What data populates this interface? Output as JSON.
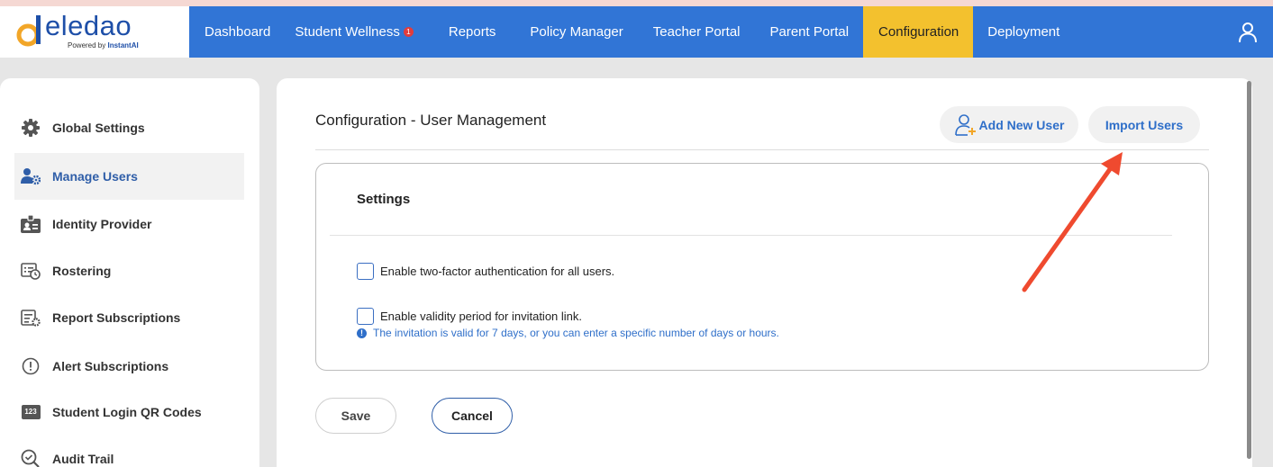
{
  "brand": {
    "name": "eledao",
    "powered_prefix": "Powered by",
    "powered_brand": "InstantAI"
  },
  "nav": {
    "items": [
      {
        "label": "Dashboard",
        "active": false
      },
      {
        "label": "Student Wellness",
        "active": false,
        "badge": "1"
      },
      {
        "label": "Reports",
        "active": false
      },
      {
        "label": "Policy Manager",
        "active": false
      },
      {
        "label": "Teacher Portal",
        "active": false
      },
      {
        "label": "Parent Portal",
        "active": false
      },
      {
        "label": "Configuration",
        "active": true
      },
      {
        "label": "Deployment",
        "active": false
      }
    ],
    "user_icon": "user-icon"
  },
  "sidebar": {
    "items": [
      {
        "label": "Global Settings",
        "icon": "gear-icon",
        "active": false
      },
      {
        "label": "Manage Users",
        "icon": "users-gear-icon",
        "active": true
      },
      {
        "label": "Identity Provider",
        "icon": "id-badge-icon",
        "active": false
      },
      {
        "label": "Rostering",
        "icon": "roster-icon",
        "active": false
      },
      {
        "label": "Report Subscriptions",
        "icon": "report-settings-icon",
        "active": false
      },
      {
        "label": "Alert Subscriptions",
        "icon": "alert-circle-icon",
        "active": false
      },
      {
        "label": "Student Login QR Codes",
        "icon": "numbers-icon",
        "icon_text": "123",
        "active": false
      },
      {
        "label": "Audit Trail",
        "icon": "search-check-icon",
        "active": false
      }
    ]
  },
  "main": {
    "title": "Configuration - User Management",
    "add_user_label": "Add New User",
    "import_users_label": "Import Users",
    "settings": {
      "title": "Settings",
      "two_factor_label": "Enable two-factor authentication for all users.",
      "two_factor_checked": false,
      "validity_label": "Enable validity period for invitation link.",
      "validity_checked": false,
      "hint": "The invitation is valid for 7 days, or you can enter a specific number of days or hours.",
      "hint_icon": "info-icon"
    },
    "save_label": "Save",
    "cancel_label": "Cancel"
  },
  "colors": {
    "header_blue": "#3175d6",
    "active_nav": "#f3c12e",
    "accent_blue": "#2f6fc9",
    "arrow_red": "#ef4a2f"
  }
}
